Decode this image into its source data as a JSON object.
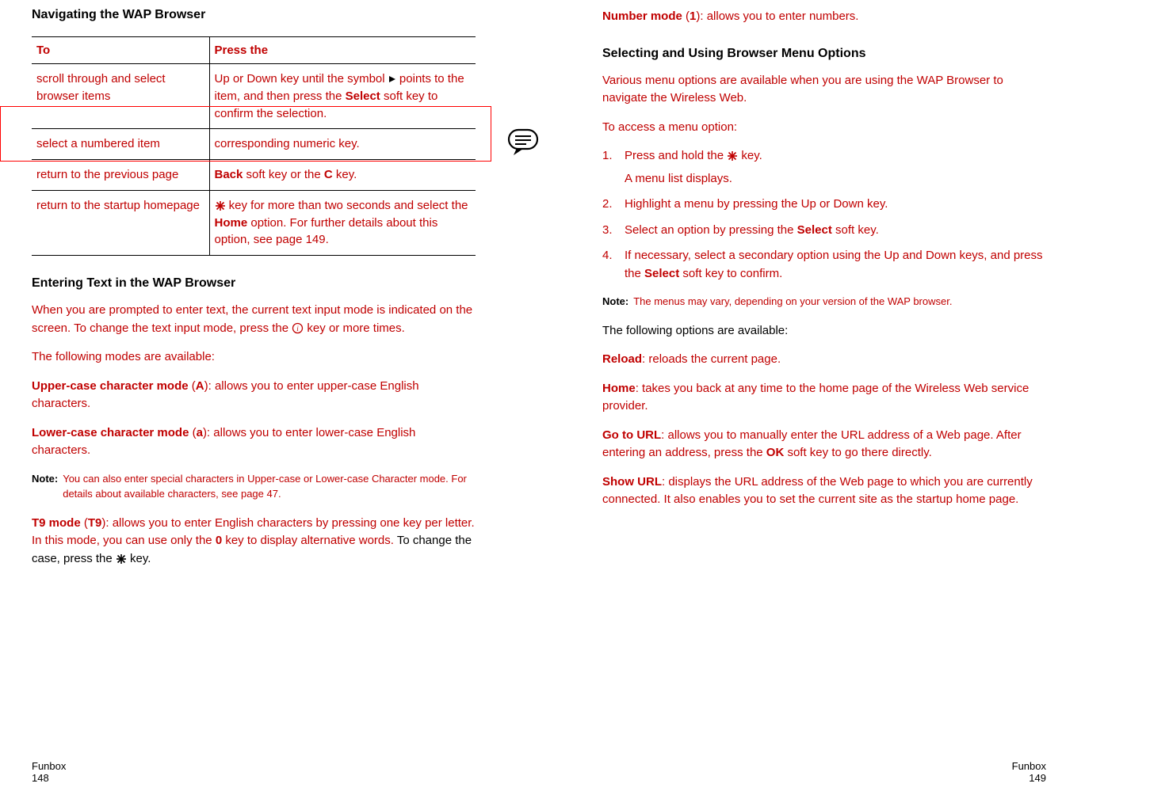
{
  "left": {
    "h_nav": "Navigating the WAP Browser",
    "table": {
      "th_to": "To",
      "th_press": "Press the",
      "rows": [
        {
          "to": "scroll through and select browser items",
          "press_a": "Up or Down key until the symbol ",
          "press_b": " points to the item, and then press the ",
          "press_c": "Select",
          "press_d": " soft key to confirm the selection."
        },
        {
          "to": "select a numbered item",
          "press_a": "corresponding numeric key."
        },
        {
          "to": "return to the previous page",
          "press_a": "Back",
          "press_b": " soft key or the ",
          "press_c": "C",
          "press_d": " key."
        },
        {
          "to": "return to the startup homepage",
          "press_a": " key for more than two seconds and select the ",
          "press_b": "Home",
          "press_c": " option. For further details about this option, see page 149."
        }
      ]
    },
    "h_entering": "Entering Text in the WAP Browser",
    "p_enter1a": "When you are prompted to enter text, the current text input mode is indicated on the screen. To change the text input mode, press the ",
    "p_enter1b": " key or more times.",
    "p_modes": "The following modes are available:",
    "p_upper_a": "Upper-case character mode",
    "p_upper_b": " (",
    "p_upper_c": "A",
    "p_upper_d": "): allows you to enter upper-case English characters.",
    "p_lower_a": "Lower-case character mode",
    "p_lower_b": " (",
    "p_lower_c": "a",
    "p_lower_d": "): allows you to enter lower-case English characters.",
    "note1_label": "Note:",
    "note1_content": "You can also enter special characters in Upper-case or Lower-case Character mode. For details about available characters, see page 47.",
    "p_t9_a": "T9 mode",
    "p_t9_b": " (",
    "p_t9_c": "T9",
    "p_t9_d": "): allows you to enter English characters by pressing one key per letter. In this mode, you can use only the ",
    "p_t9_e": "0",
    "p_t9_f": " key to display alternative words. ",
    "p_t9_g": "To change the case, press the ",
    "p_t9_h": " key.",
    "footer_label": "Funbox",
    "footer_page": "148"
  },
  "right": {
    "p_num_a": "Number mode",
    "p_num_b": " (",
    "p_num_c": "1",
    "p_num_d": "): allows you to enter numbers.",
    "h_menuopts": "Selecting and Using Browser Menu Options",
    "p_menu1": "Various menu options are available when you are using the WAP Browser to navigate the Wireless Web.",
    "p_menu2": "To access a menu option:",
    "ol": {
      "n1": "1.",
      "li1a": "Press and hold the ",
      "li1b": " key.",
      "li1c": "A menu list displays.",
      "n2": "2.",
      "li2": "Highlight a menu by pressing the Up or Down key.",
      "n3": "3.",
      "li3a": "Select an option by pressing the ",
      "li3b": "Select",
      "li3c": " soft key.",
      "n4": "4.",
      "li4a": "If necessary, select a secondary option using the Up and Down keys, and press the ",
      "li4b": "Select",
      "li4c": " soft key to confirm."
    },
    "note_label": "Note:",
    "note_content": "The menus may vary, depending on your version of the WAP browser.",
    "p_avail": "The following options are available:",
    "p_reload_a": "Reload",
    "p_reload_b": ": reloads the current page.",
    "p_home_a": "Home",
    "p_home_b": ": takes you back at any time to the home page of the Wireless Web service provider.",
    "p_gourl_a": "Go to URL",
    "p_gourl_b": ": allows you to manually enter the URL address of a Web page. After entering an address, press the ",
    "p_gourl_c": "OK",
    "p_gourl_d": " soft key to go there directly.",
    "p_showurl_a": "Show URL",
    "p_showurl_b": ": displays the URL address of the Web page to which you are currently connected. It also enables you to set the current site as the startup home page.",
    "footer_label": "Funbox",
    "footer_page": "149"
  }
}
